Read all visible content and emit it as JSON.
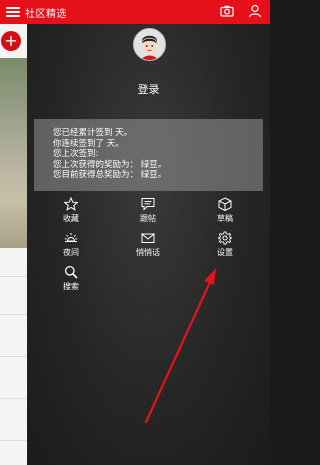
{
  "topbar": {
    "title": "社区精选",
    "menu_icon": "hamburger-icon",
    "camera_icon": "camera-icon",
    "user_icon": "user-icon",
    "color": "#e5101a"
  },
  "page": {
    "add_icon": "+"
  },
  "drawer": {
    "avatar_icon": "avatar-icon",
    "login_label": "登录",
    "stats": [
      "您已经累计签到 天。",
      "你连续签到了 天。",
      "您上次签到:",
      "您上次获得的奖励为： 绿豆。",
      "您目前获得总奖励为： 绿豆。"
    ],
    "menu": [
      {
        "label": "收藏",
        "icon": "star-icon"
      },
      {
        "label": "跟帖",
        "icon": "comment-icon"
      },
      {
        "label": "草稿",
        "icon": "box-icon"
      },
      {
        "label": "夜间",
        "icon": "sun-icon"
      },
      {
        "label": "悄悄话",
        "icon": "mail-icon"
      },
      {
        "label": "设置",
        "icon": "gear-icon"
      },
      {
        "label": "搜索",
        "icon": "search-icon"
      }
    ]
  },
  "annotation": {
    "color": "#e8121a"
  }
}
